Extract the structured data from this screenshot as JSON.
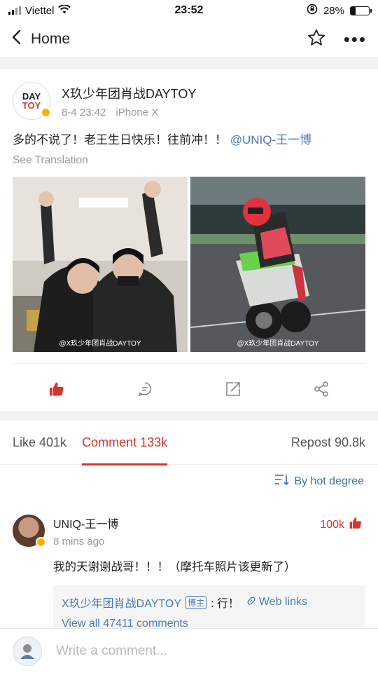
{
  "status_bar": {
    "carrier": "Viettel",
    "time": "23:52",
    "battery": "28%",
    "battery_level": 0.28
  },
  "nav": {
    "back_label": "Home",
    "more_label": "•••"
  },
  "post": {
    "author": "X玖少年团肖战DAYTOY",
    "logo_line1": "DAY",
    "logo_line2": "TOY",
    "date": "8-4 23:42",
    "device": "iPhone X",
    "text": "多的不说了！老王生日快乐！往前冲！！",
    "mention": "@UNIQ-王一博",
    "see_translation": "See Translation",
    "photo_watermarks": [
      "@X玖少年团肖战DAYTOY",
      "@X玖少年团肖战DAYTOY"
    ]
  },
  "tabs": {
    "like": "Like 401k",
    "comment": "Comment 133k",
    "repost": "Repost 90.8k"
  },
  "sort": {
    "label": "By hot degree"
  },
  "comment": {
    "name": "UNIQ-王一博",
    "time": "8 mins ago",
    "likes": "100k",
    "text": "我的天谢谢战哥！！！（摩托车照片该更新了）",
    "reply_author": "X玖少年团肖战DAYTOY",
    "reply_badge": "博主",
    "reply_text": ": 行！",
    "reply_link": "Web links",
    "view_all": "View all 47411 comments"
  },
  "input": {
    "placeholder": "Write a comment..."
  },
  "colors": {
    "accent_red": "#d9342b",
    "link_blue": "#4a79b5"
  }
}
